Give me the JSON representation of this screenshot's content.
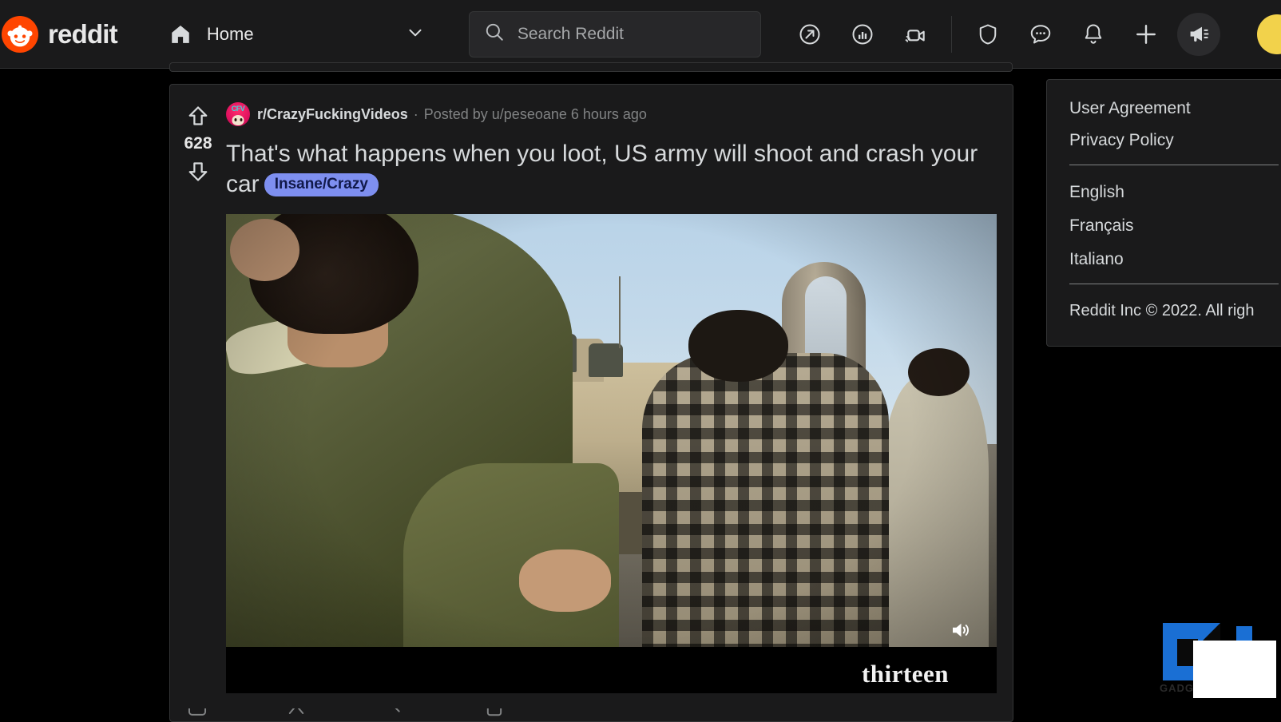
{
  "header": {
    "logo_text": "reddit",
    "logo_icon": "reddit-snoo-icon",
    "nav": {
      "home_label": "Home",
      "home_icon": "home-icon",
      "chevron_icon": "chevron-down-icon"
    },
    "search": {
      "placeholder": "Search Reddit",
      "value": "",
      "icon": "search-icon"
    },
    "icons": [
      {
        "name": "trending-icon",
        "label": "Trending"
      },
      {
        "name": "popular-icon",
        "label": "Popular"
      },
      {
        "name": "live-video-icon",
        "label": "Reddit Live"
      },
      {
        "name": "shield-icon",
        "label": "Mod"
      },
      {
        "name": "chat-icon",
        "label": "Chat"
      },
      {
        "name": "bell-icon",
        "label": "Notifications"
      },
      {
        "name": "plus-icon",
        "label": "Create Post"
      },
      {
        "name": "megaphone-icon",
        "label": "Advertise"
      }
    ],
    "avatar": "user-avatar"
  },
  "post": {
    "score": "628",
    "upvote_icon": "upvote-arrow-icon",
    "downvote_icon": "downvote-arrow-icon",
    "subreddit": "r/CrazyFuckingVideos",
    "subreddit_avatar_text": "CFV",
    "separator": "·",
    "posted_by": "Posted by u/peseoane 6 hours ago",
    "title": "That's what happens when you loot, US army will shoot and crash your car",
    "flair": "Insane/Crazy",
    "flair_bg": "#7e8ff0",
    "flair_color": "#11194a",
    "video": {
      "watermark": "thirteen",
      "volume_icon": "volume-on-icon",
      "scene_description": "Street scene with US army tank and onlookers"
    },
    "actions": [
      {
        "name": "comments-action",
        "icon": "comment-icon"
      },
      {
        "name": "award-action",
        "icon": "award-icon"
      },
      {
        "name": "share-action",
        "icon": "share-icon"
      },
      {
        "name": "save-action",
        "icon": "save-icon"
      }
    ]
  },
  "sidebar": {
    "links": [
      {
        "label": "User Agreement"
      },
      {
        "label": "Privacy Policy"
      }
    ],
    "languages": [
      {
        "label": "English"
      },
      {
        "label": "Français"
      },
      {
        "label": "Italiano"
      }
    ],
    "copyright": "Reddit Inc © 2022. All righ"
  },
  "watermark": {
    "brand": "GADGETS"
  },
  "colors": {
    "brand_orange": "#ff4500",
    "card_bg": "#1a1a1b",
    "page_bg": "#000000",
    "border": "#343536",
    "text_primary": "#d7dadc",
    "text_muted": "#818384"
  }
}
